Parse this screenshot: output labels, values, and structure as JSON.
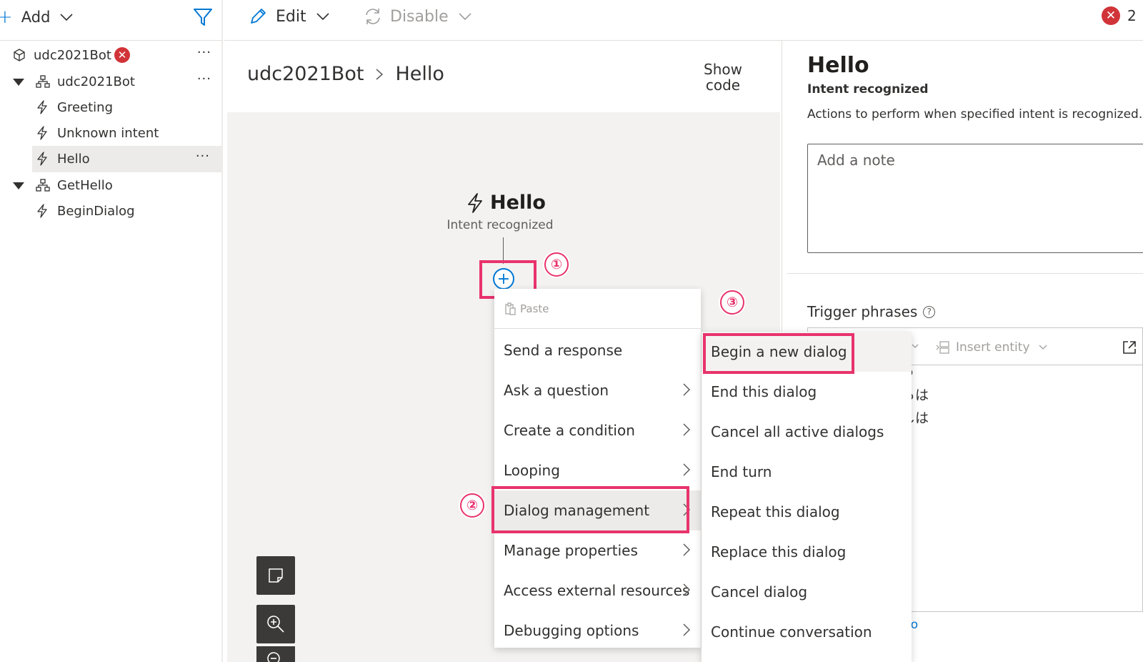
{
  "sidebar": {
    "add_label": "Add",
    "tree": [
      {
        "label": "udc2021Bot",
        "icon": "bot-icon",
        "has_error": true,
        "error_glyph": "✕"
      },
      {
        "label": "udc2021Bot",
        "icon": "dialog-icon",
        "expanded": true
      },
      {
        "label": "Greeting",
        "icon": "trigger-icon"
      },
      {
        "label": "Unknown intent",
        "icon": "trigger-icon"
      },
      {
        "label": "Hello",
        "icon": "trigger-icon",
        "selected": true
      },
      {
        "label": "GetHello",
        "icon": "dialog-icon",
        "expanded": true
      },
      {
        "label": "BeginDialog",
        "icon": "trigger-icon"
      }
    ],
    "more_glyph": "···"
  },
  "toolbar": {
    "edit_label": "Edit",
    "disable_label": "Disable",
    "error_count": "2",
    "error_glyph": "✕"
  },
  "canvas": {
    "breadcrumb": [
      "udc2021Bot",
      "Hello"
    ],
    "show_code_label": "Show\ncode",
    "node_title": "Hello",
    "node_subtitle": "Intent recognized",
    "add_glyph": "+"
  },
  "annotations": [
    "①",
    "②",
    "③"
  ],
  "add_menu": {
    "paste_label": "Paste",
    "items": [
      {
        "label": "Send a response",
        "submenu": false
      },
      {
        "label": "Ask a question",
        "submenu": true
      },
      {
        "label": "Create a condition",
        "submenu": true
      },
      {
        "label": "Looping",
        "submenu": true
      },
      {
        "label": "Dialog management",
        "submenu": true,
        "active": true
      },
      {
        "label": "Manage properties",
        "submenu": true
      },
      {
        "label": "Access external resources",
        "submenu": true
      },
      {
        "label": "Debugging options",
        "submenu": true
      }
    ]
  },
  "submenu": {
    "items": [
      {
        "label": "Begin a new dialog",
        "active": true
      },
      {
        "label": "End this dialog"
      },
      {
        "label": "Cancel all active dialogs"
      },
      {
        "label": "End turn"
      },
      {
        "label": "Repeat this dialog"
      },
      {
        "label": "Replace this dialog"
      },
      {
        "label": "Cancel dialog"
      },
      {
        "label": "Continue conversation"
      }
    ]
  },
  "panel": {
    "title": "Hello",
    "subtitle": "Intent recognized",
    "description": "Actions to perform when specified intent is recognized.",
    "note_placeholder": "Add a note",
    "trigger_label": "Trigger phrases",
    "help_glyph": "?",
    "insert_entity_label": "Insert entity",
    "editor_lines": [
      "う",
      "らは",
      "しは"
    ],
    "editor_link": "lo"
  },
  "colors": {
    "accent": "#0078d4",
    "highlight": "#e8336d",
    "error": "#d13438"
  }
}
